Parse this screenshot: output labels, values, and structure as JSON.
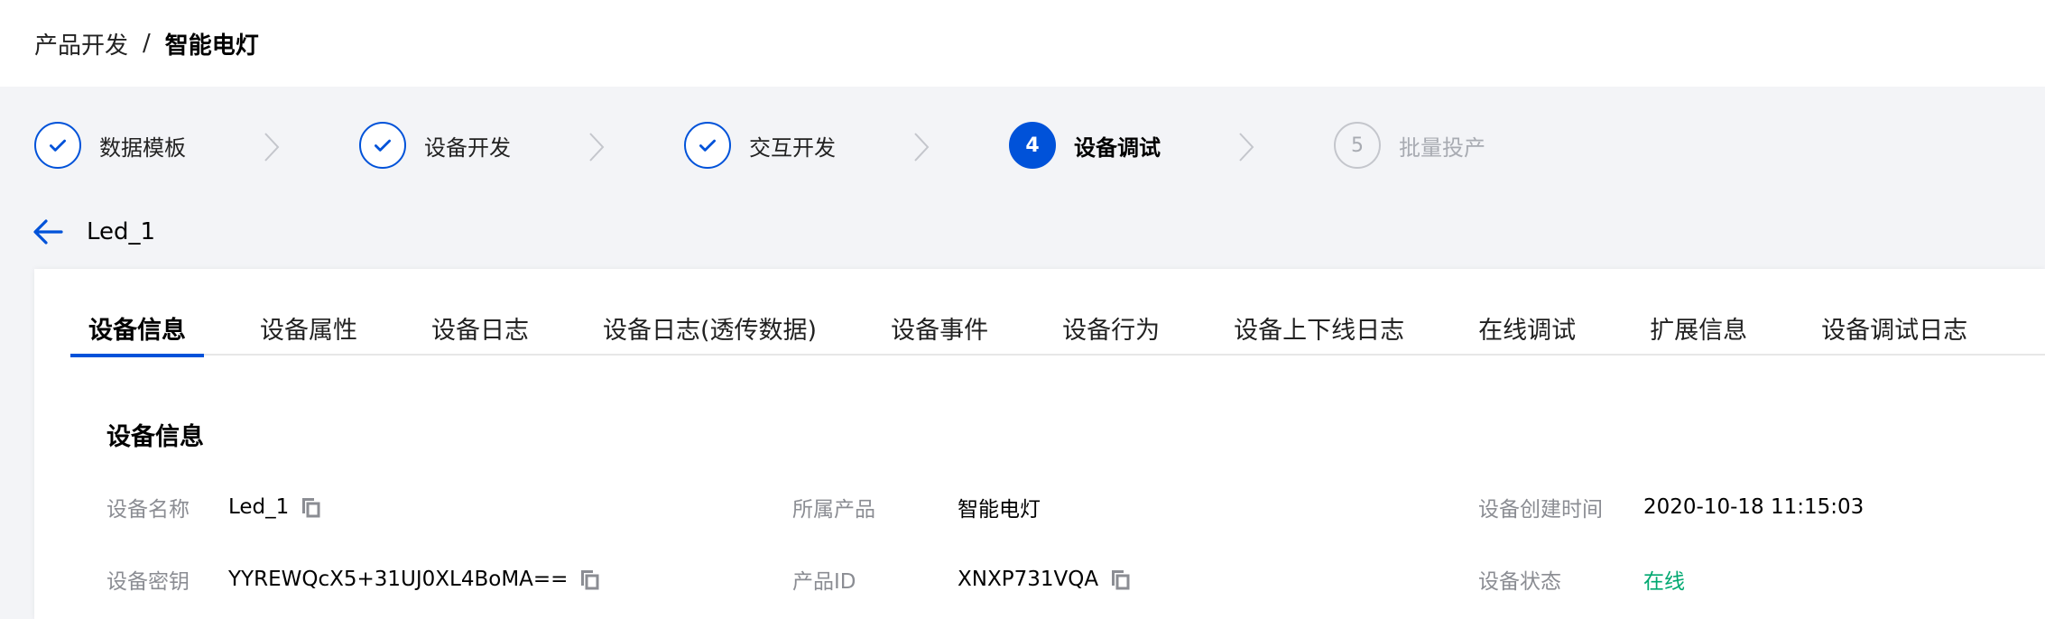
{
  "breadcrumb": {
    "parent": "产品开发",
    "separator": "/",
    "current": "智能电灯"
  },
  "steps": [
    {
      "label": "数据模板",
      "state": "done"
    },
    {
      "label": "设备开发",
      "state": "done"
    },
    {
      "label": "交互开发",
      "state": "done"
    },
    {
      "number": "4",
      "label": "设备调试",
      "state": "active"
    },
    {
      "number": "5",
      "label": "批量投产",
      "state": "pending"
    }
  ],
  "device": {
    "title": "Led_1"
  },
  "tabs": [
    "设备信息",
    "设备属性",
    "设备日志",
    "设备日志(透传数据)",
    "设备事件",
    "设备行为",
    "设备上下线日志",
    "在线调试",
    "扩展信息",
    "设备调试日志"
  ],
  "active_tab": "设备信息",
  "info": {
    "section_title": "设备信息",
    "fields": [
      {
        "label": "设备名称",
        "value": "Led_1",
        "copy": true
      },
      {
        "label": "所属产品",
        "value": "智能电灯",
        "copy": false
      },
      {
        "label": "设备创建时间",
        "value": "2020-10-18 11:15:03",
        "copy": false
      },
      {
        "label": "设备密钥",
        "value": "YYREWQcX5+31UJ0XL4BoMA==",
        "copy": true
      },
      {
        "label": "产品ID",
        "value": "XNXP731VQA",
        "copy": true
      },
      {
        "label": "设备状态",
        "value": "在线",
        "copy": false
      }
    ]
  },
  "colors": {
    "accent": "#0052d9",
    "online": "#00a870",
    "muted": "#8b8d93"
  },
  "icons": {
    "done": "check-icon",
    "divider": "chevron-right-icon",
    "back": "arrow-left-icon",
    "copy": "copy-icon"
  }
}
